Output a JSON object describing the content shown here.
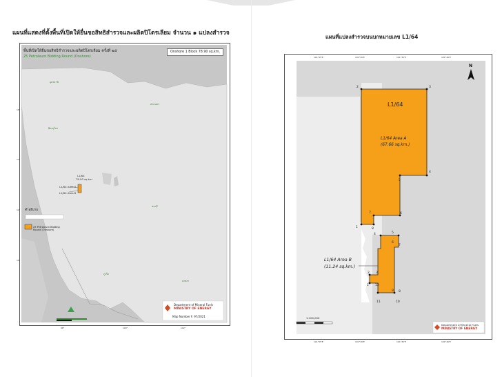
{
  "titles": {
    "left": "แผนที่แสดงที่ตั้งพื้นที่เปิดให้ยื่นขอสิทธิสำรวจและผลิตปิโตรเลียม จำนวน ๑ แปลงสำรวจ",
    "right": "แผนที่แปลงสำรวจบนบกหมายเลข L1/64"
  },
  "left_map": {
    "header": "พื้นที่เปิดให้ยื่นขอสิทธิสำรวจและผลิตปิโตรเลียม ครั้งที่ ๒๕",
    "subheader": "25  Petroleum Bidding Round (Onshore)",
    "onshore_box": "Onshore 1 Block 78.90 sq.km.",
    "block_label_1": "L1/64",
    "block_label_2": "78.90 sq.km.",
    "area_a_label": "L1/64 Area A",
    "area_b_label": "L1/64 Area B",
    "legend_title": "คำอธิบาย",
    "legend_item": "25  Petroleum Bidding Round (Onshore)",
    "org_name": "Department of Mineral Fuels",
    "ministry": "MINISTRY OF ENERGY",
    "map_number": "Map Number F. 97/2021",
    "colors": {
      "land": "#e3e3e3",
      "sea": "#c6c6c6",
      "block": "#f5a018",
      "frame": "#555555"
    }
  },
  "right_map": {
    "block_title": "L1/64",
    "area_a_title": "L1/64 Area A",
    "area_a_size": "(67.66 sq.km.)",
    "area_b_title": "L1/64 Area B",
    "area_b_size": "(11.24 sq.km.)",
    "north_label": "N",
    "scale": "1:100,000",
    "org_name": "Department of Mineral Fuels",
    "ministry": "MINISTRY OF ENERGY",
    "vertex_labels": [
      "1",
      "2",
      "3",
      "4",
      "5",
      "6",
      "7",
      "8",
      "9",
      "10",
      "11",
      "12"
    ],
    "colors": {
      "block": "#f5a018",
      "grey": "#d8d8d8",
      "frame": "#555555"
    }
  }
}
